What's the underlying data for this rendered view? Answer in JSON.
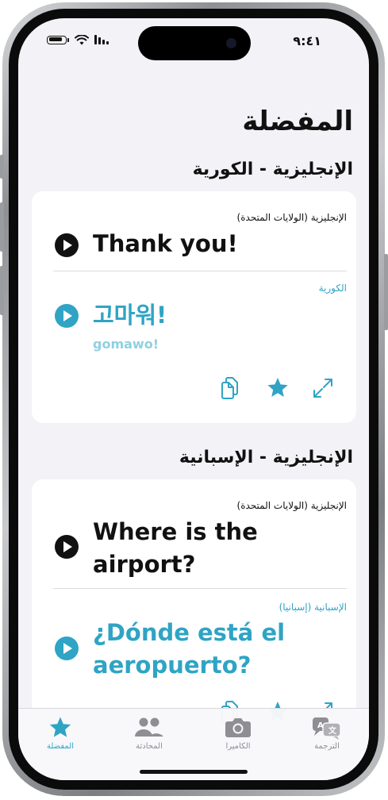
{
  "status_bar": {
    "time": "٩:٤١"
  },
  "header": {
    "title": "المفضلة"
  },
  "sections": [
    {
      "title": "الإنجليزية - الكورية",
      "source_language": "الإنجليزية (الولايات المتحدة)",
      "source_text": "Thank you!",
      "target_language": "الكورية",
      "target_text": "고마워!",
      "romanization": "gomawo!"
    },
    {
      "title": "الإنجليزية - الإسبانية",
      "source_language": "الإنجليزية (الولايات المتحدة)",
      "source_lines": [
        "Where is the",
        "airport?"
      ],
      "target_language": "الإسبانية (إسبانيا)",
      "target_lines": [
        "¿Dónde está el",
        "aeropuerto?"
      ]
    }
  ],
  "tabs": [
    {
      "label": "المفضلة",
      "icon": "star-icon",
      "active": true
    },
    {
      "label": "المحادثة",
      "icon": "people-icon",
      "active": false
    },
    {
      "label": "الكاميرا",
      "icon": "camera-icon",
      "active": false
    },
    {
      "label": "الترجمة",
      "icon": "translate-icon",
      "active": false
    }
  ],
  "colors": {
    "accent": "#2fa4c4",
    "inactive_tab": "#8e8e93",
    "background": "#f2f2f7"
  }
}
